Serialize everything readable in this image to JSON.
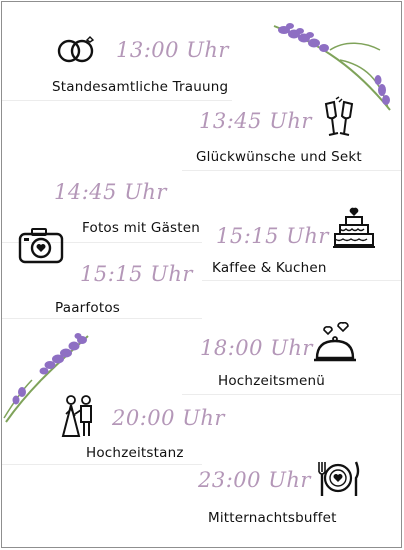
{
  "events": [
    {
      "time": "13:00 Uhr",
      "label": "Standesamtliche Trauung",
      "icon": "wedding-rings-icon"
    },
    {
      "time": "13:45 Uhr",
      "label": "Glückwünsche und Sekt",
      "icon": "champagne-toast-icon"
    },
    {
      "time": "14:45 Uhr",
      "label": "Fotos mit Gästen",
      "icon": "camera-icon"
    },
    {
      "time": "15:15 Uhr",
      "label": "Kaffee & Kuchen",
      "icon": "wedding-cake-icon"
    },
    {
      "time": "15:15 Uhr",
      "label": "Paarfotos",
      "icon": "camera-icon"
    },
    {
      "time": "18:00 Uhr",
      "label": "Hochzeitsmenü",
      "icon": "cloche-hearts-icon"
    },
    {
      "time": "20:00 Uhr",
      "label": "Hochzeitstanz",
      "icon": "wedding-couple-icon"
    },
    {
      "time": "23:00 Uhr",
      "label": "Mitternachtsbuffet",
      "icon": "plate-cutlery-icon"
    }
  ],
  "colors": {
    "time_text": "#b497b8",
    "lavender": "#8e6fc3",
    "leaf": "#7fa35a",
    "label_text": "#111111"
  },
  "decorations": [
    "lavender-sprig-top-right",
    "lavender-sprig-left"
  ]
}
